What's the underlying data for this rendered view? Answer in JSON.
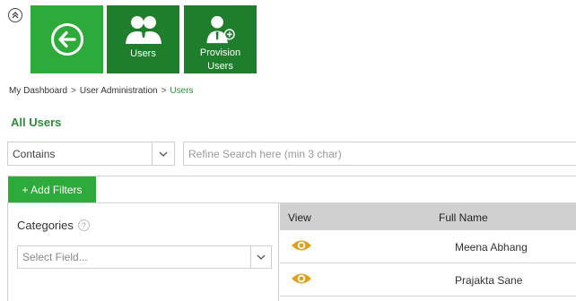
{
  "nav": {
    "back_tile": {
      "icon": "arrow-left-circle-icon"
    },
    "users_tile": {
      "label": "Users",
      "icon": "users-group-icon"
    },
    "provision_tile": {
      "label_line1": "Provision",
      "label_line2": "Users",
      "icon": "user-add-icon"
    },
    "collapse_icon": "double-chevron-up-icon"
  },
  "breadcrumb": {
    "items": [
      "My Dashboard",
      "User Administration",
      "Users"
    ],
    "separator": ">"
  },
  "page": {
    "title": "All Users"
  },
  "search": {
    "mode_selected": "Contains",
    "placeholder": "Refine Search here (min 3 char)",
    "value": ""
  },
  "filters": {
    "add_label": "+ Add Filters"
  },
  "categories": {
    "title": "Categories",
    "help": "?",
    "field_placeholder": "Select Field..."
  },
  "grid": {
    "columns": [
      "View",
      "Full Name"
    ],
    "rows": [
      {
        "full_name": "Meena Abhang"
      },
      {
        "full_name": "Prajakta Sane"
      }
    ]
  },
  "colors": {
    "tile_light": "#2daa3a",
    "tile_dark": "#1e7e2c",
    "accent_text": "#2e8b3a",
    "eye_icon": "#e0a020",
    "grid_header": "#d0d0d0"
  }
}
